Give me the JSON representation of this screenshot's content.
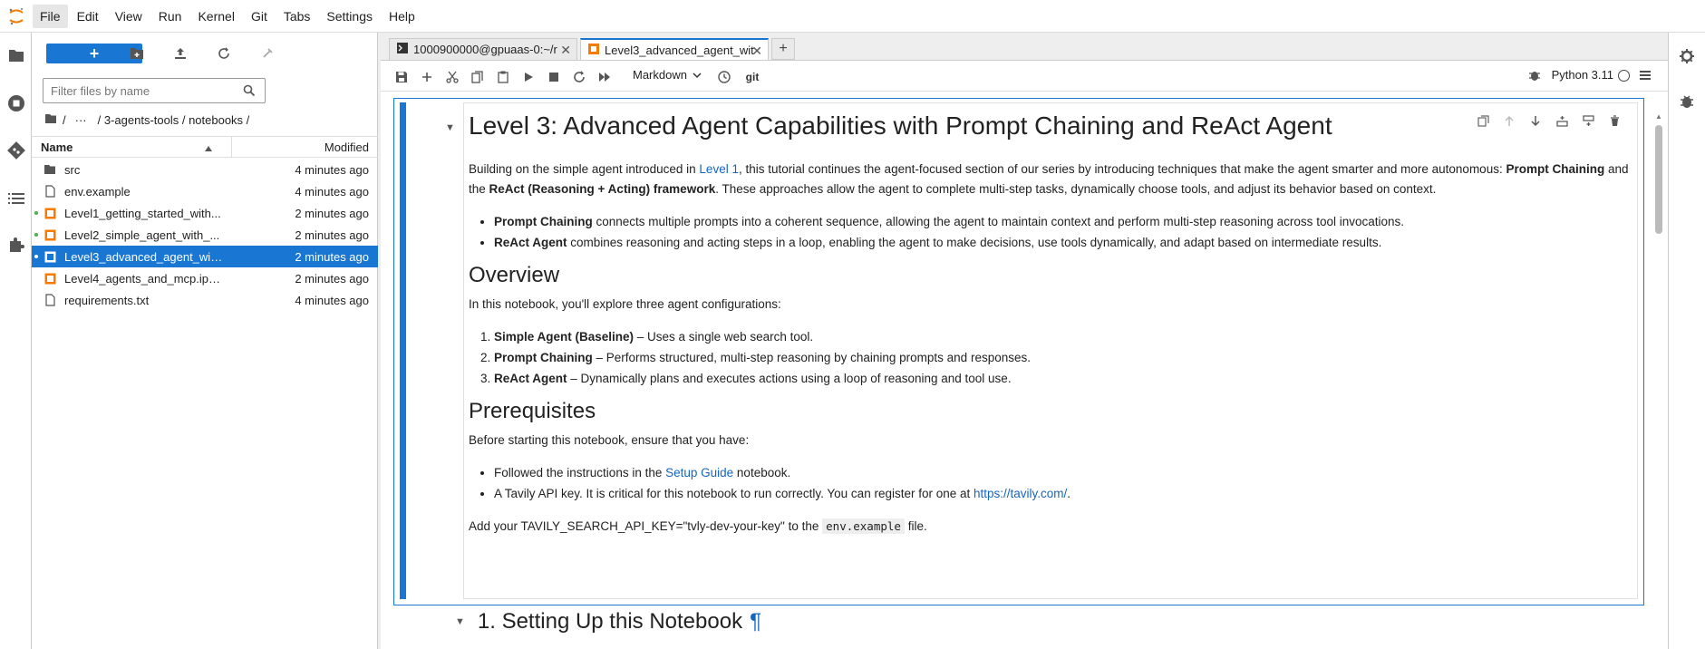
{
  "menubar": {
    "items": [
      "File",
      "Edit",
      "View",
      "Run",
      "Kernel",
      "Git",
      "Tabs",
      "Settings",
      "Help"
    ]
  },
  "filebrowser": {
    "new_label": "+",
    "filter_placeholder": "Filter files by name",
    "breadcrumb": [
      "/",
      "···",
      "/ 3-agents-tools / notebooks /"
    ],
    "col_name": "Name",
    "col_modified": "Modified",
    "files": [
      {
        "name": "src",
        "modified": "4 minutes ago",
        "type": "folder"
      },
      {
        "name": "env.example",
        "modified": "4 minutes ago",
        "type": "file"
      },
      {
        "name": "Level1_getting_started_with...",
        "modified": "2 minutes ago",
        "type": "notebook"
      },
      {
        "name": "Level2_simple_agent_with_...",
        "modified": "2 minutes ago",
        "type": "notebook"
      },
      {
        "name": "Level3_advanced_agent_wit...",
        "modified": "2 minutes ago",
        "type": "notebook"
      },
      {
        "name": "Level4_agents_and_mcp.ipynb",
        "modified": "2 minutes ago",
        "type": "notebook"
      },
      {
        "name": "requirements.txt",
        "modified": "4 minutes ago",
        "type": "file"
      }
    ]
  },
  "tabs": [
    {
      "label": "1000900000@gpuaas-0:~/r"
    },
    {
      "label": "Level3_advanced_agent_wit"
    }
  ],
  "notebook": {
    "cell_type": "Markdown",
    "git_label": "git",
    "kernel": "Python 3.11",
    "h1": "Level 3: Advanced Agent Capabilities with Prompt Chaining and ReAct Agent",
    "intro": {
      "a": "Building on the simple agent introduced in ",
      "link": "Level 1",
      "b": ", this tutorial continues the agent-focused section of our series by introducing techniques that make the agent smarter and more autonomous: ",
      "bold1": "Prompt Chaining",
      "c": " and the ",
      "bold2": "ReAct (Reasoning + Acting) framework",
      "d": ". These approaches allow the agent to complete multi-step tasks, dynamically choose tools, and adjust its behavior based on context."
    },
    "bullets": [
      {
        "bold": "Prompt Chaining",
        "text": " connects multiple prompts into a coherent sequence, allowing the agent to maintain context and perform multi-step reasoning across tool invocations."
      },
      {
        "bold": "ReAct Agent",
        "text": " combines reasoning and acting steps in a loop, enabling the agent to make decisions, use tools dynamically, and adapt based on intermediate results."
      }
    ],
    "overview_h": "Overview",
    "overview_p": "In this notebook, you'll explore three agent configurations:",
    "configs": [
      {
        "bold": "Simple Agent (Baseline)",
        "text": " – Uses a single web search tool."
      },
      {
        "bold": "Prompt Chaining",
        "text": " – Performs structured, multi-step reasoning by chaining prompts and responses."
      },
      {
        "bold": "ReAct Agent",
        "text": " – Dynamically plans and executes actions using a loop of reasoning and tool use."
      }
    ],
    "prereq_h": "Prerequisites",
    "prereq_p": "Before starting this notebook, ensure that you have:",
    "prereq1": {
      "a": "Followed the instructions in the ",
      "link": "Setup Guide",
      "b": " notebook."
    },
    "prereq2": {
      "a": "A Tavily API key. It is critical for this notebook to run correctly. You can register for one at ",
      "link": "https://tavily.com/",
      "b": "."
    },
    "env_line": {
      "a": "Add your TAVILY_SEARCH_API_KEY=\"tvly-dev-your-key\" to the ",
      "code": "env.example",
      "b": " file."
    },
    "next_heading": "1. Setting Up this Notebook",
    "pilcrow": "¶"
  },
  "colors": {
    "accent": "#1976d2",
    "link": "#1565c0",
    "orange": "#f57c00"
  }
}
